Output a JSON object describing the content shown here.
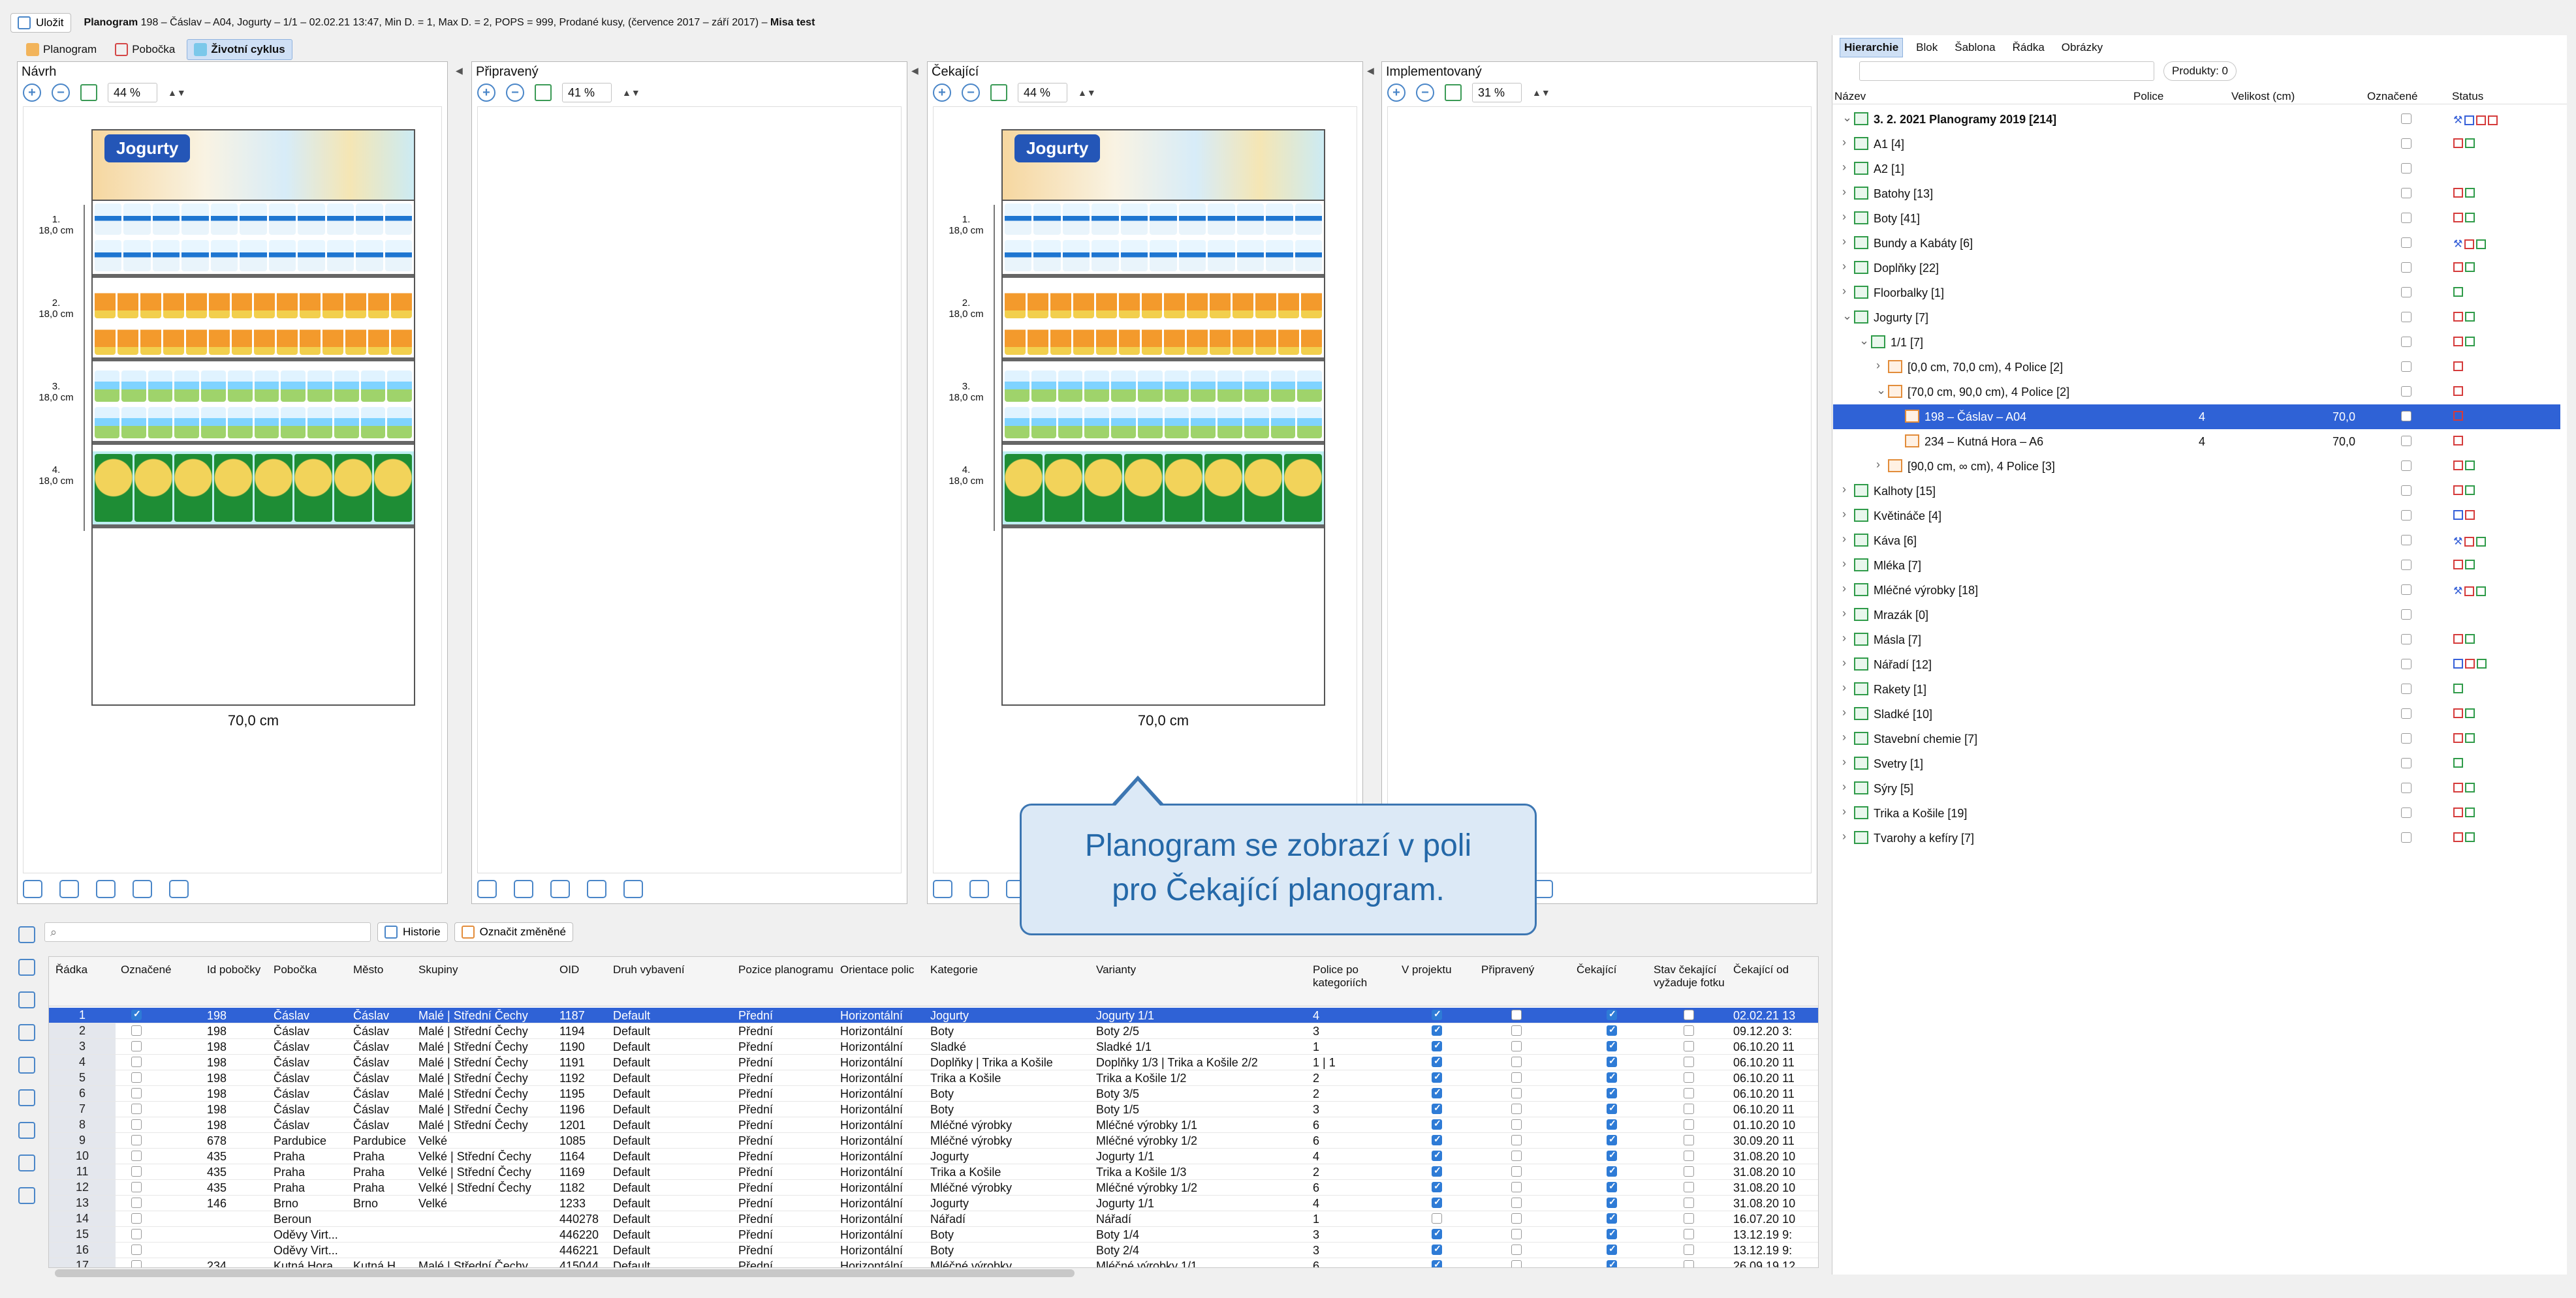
{
  "toolbar": {
    "save_label": "Uložit",
    "title_bold": "Planogram",
    "title_rest": " 198 – Čáslav – A04, Jogurty – 1/1 – 02.02.21 13:47, Min D. = 1, Max D. = 2, POPS = 999, Prodané kusy, (července 2017 – září 2017) – ",
    "title_user": "Misa test"
  },
  "view_tabs": [
    "Planogram",
    "Pobočka",
    "Životní cyklus"
  ],
  "panels": [
    {
      "title": "Návrh",
      "zoom": "44 %"
    },
    {
      "title": "Připravený",
      "zoom": "41 %"
    },
    {
      "title": "Čekající",
      "zoom": "44 %"
    },
    {
      "title": "Implementovaný",
      "zoom": "31 %"
    }
  ],
  "planogram": {
    "brand": "Jogurty",
    "shelves": [
      "1.",
      "2.",
      "3.",
      "4."
    ],
    "shelf_height": "18,0 cm",
    "width_label": "70,0 cm"
  },
  "callout": {
    "line1": "Planogram se zobrazí v poli",
    "line2": "pro Čekající planogram."
  },
  "list_toolbar": {
    "search_placeholder": "",
    "history_label": "Historie",
    "mark_changed_label": "Označit změněné"
  },
  "table": {
    "headers": [
      "Řádka",
      "Označené",
      "Id pobočky",
      "Pobočka",
      "Město",
      "Skupiny",
      "OID",
      "Druh vybavení",
      "Pozice planogramu",
      "Orientace polic",
      "Kategorie",
      "Varianty",
      "Police po kategoriích",
      "V projektu",
      "Připravený",
      "Čekající",
      "Stav čekající vyžaduje fotku",
      "Čekající od"
    ],
    "rows": [
      [
        "1",
        true,
        "198",
        "Čáslav",
        "Čáslav",
        "Malé | Střední Čechy",
        "1187",
        "Default",
        "Přední",
        "Horizontální",
        "Jogurty",
        "Jogurty 1/1",
        "4",
        true,
        false,
        true,
        false,
        "02.02.21 13"
      ],
      [
        "2",
        false,
        "198",
        "Čáslav",
        "Čáslav",
        "Malé | Střední Čechy",
        "1194",
        "Default",
        "Přední",
        "Horizontální",
        "Boty",
        "Boty 2/5",
        "3",
        true,
        false,
        true,
        false,
        "09.12.20 3:"
      ],
      [
        "3",
        false,
        "198",
        "Čáslav",
        "Čáslav",
        "Malé | Střední Čechy",
        "1190",
        "Default",
        "Přední",
        "Horizontální",
        "Sladké",
        "Sladké 1/1",
        "1",
        true,
        false,
        true,
        false,
        "06.10.20 11"
      ],
      [
        "4",
        false,
        "198",
        "Čáslav",
        "Čáslav",
        "Malé | Střední Čechy",
        "1191",
        "Default",
        "Přední",
        "Horizontální",
        "Doplňky | Trika a Košile",
        "Doplňky 1/3 | Trika a Košile 2/2",
        "1 | 1",
        true,
        false,
        true,
        false,
        "06.10.20 11"
      ],
      [
        "5",
        false,
        "198",
        "Čáslav",
        "Čáslav",
        "Malé | Střední Čechy",
        "1192",
        "Default",
        "Přední",
        "Horizontální",
        "Trika a Košile",
        "Trika a Košile 1/2",
        "2",
        true,
        false,
        true,
        false,
        "06.10.20 11"
      ],
      [
        "6",
        false,
        "198",
        "Čáslav",
        "Čáslav",
        "Malé | Střední Čechy",
        "1195",
        "Default",
        "Přední",
        "Horizontální",
        "Boty",
        "Boty 3/5",
        "2",
        true,
        false,
        true,
        false,
        "06.10.20 11"
      ],
      [
        "7",
        false,
        "198",
        "Čáslav",
        "Čáslav",
        "Malé | Střední Čechy",
        "1196",
        "Default",
        "Přední",
        "Horizontální",
        "Boty",
        "Boty 1/5",
        "3",
        true,
        false,
        true,
        false,
        "06.10.20 11"
      ],
      [
        "8",
        false,
        "198",
        "Čáslav",
        "Čáslav",
        "Malé | Střední Čechy",
        "1201",
        "Default",
        "Přední",
        "Horizontální",
        "Mléčné výrobky",
        "Mléčné výrobky 1/1",
        "6",
        true,
        false,
        true,
        false,
        "01.10.20 10"
      ],
      [
        "9",
        false,
        "678",
        "Pardubice",
        "Pardubice",
        "Velké",
        "1085",
        "Default",
        "Přední",
        "Horizontální",
        "Mléčné výrobky",
        "Mléčné výrobky 1/2",
        "6",
        true,
        false,
        true,
        false,
        "30.09.20 11"
      ],
      [
        "10",
        false,
        "435",
        "Praha",
        "Praha",
        "Velké | Střední Čechy",
        "1164",
        "Default",
        "Přední",
        "Horizontální",
        "Jogurty",
        "Jogurty 1/1",
        "4",
        true,
        false,
        true,
        false,
        "31.08.20 10"
      ],
      [
        "11",
        false,
        "435",
        "Praha",
        "Praha",
        "Velké | Střední Čechy",
        "1169",
        "Default",
        "Přední",
        "Horizontální",
        "Trika a Košile",
        "Trika a Košile 1/3",
        "2",
        true,
        false,
        true,
        false,
        "31.08.20 10"
      ],
      [
        "12",
        false,
        "435",
        "Praha",
        "Praha",
        "Velké | Střední Čechy",
        "1182",
        "Default",
        "Přední",
        "Horizontální",
        "Mléčné výrobky",
        "Mléčné výrobky 1/2",
        "6",
        true,
        false,
        true,
        false,
        "31.08.20 10"
      ],
      [
        "13",
        false,
        "146",
        "Brno",
        "Brno",
        "Velké",
        "1233",
        "Default",
        "Přední",
        "Horizontální",
        "Jogurty",
        "Jogurty 1/1",
        "4",
        true,
        false,
        true,
        false,
        "31.08.20 10"
      ],
      [
        "14",
        false,
        "",
        "Beroun",
        "",
        "",
        "440278",
        "Default",
        "Přední",
        "Horizontální",
        "Nářadí",
        "Nářadí",
        "1",
        false,
        false,
        true,
        false,
        "16.07.20 10"
      ],
      [
        "15",
        false,
        "",
        "Oděvy Virt...",
        "",
        "",
        "446220",
        "Default",
        "Přední",
        "Horizontální",
        "Boty",
        "Boty 1/4",
        "3",
        true,
        false,
        true,
        false,
        "13.12.19 9:"
      ],
      [
        "16",
        false,
        "",
        "Oděvy Virt...",
        "",
        "",
        "446221",
        "Default",
        "Přední",
        "Horizontální",
        "Boty",
        "Boty 2/4",
        "3",
        true,
        false,
        true,
        false,
        "13.12.19 9:"
      ],
      [
        "17",
        false,
        "234",
        "Kutná Hora",
        "Kutná H...",
        "Malé | Střední Čechy",
        "415044",
        "Default",
        "Přední",
        "Horizontální",
        "Mléčné výrobky",
        "Mléčné výrobky 1/1",
        "6",
        true,
        false,
        true,
        false,
        "26.09.19 12"
      ]
    ]
  },
  "right_tabs": [
    "Hierarchie",
    "Blok",
    "Šablona",
    "Řádka",
    "Obrázky"
  ],
  "right_filter": "Produkty: 0",
  "right_headers": {
    "name": "Název",
    "shelves": "Police",
    "size": "Velikost (cm)",
    "marked": "Označené",
    "status": "Status"
  },
  "tree": [
    {
      "label": "3. 2. 2021 Planogramy 2019 [214]",
      "bold": true,
      "status": [
        "wrench",
        "blue",
        "red",
        "red"
      ]
    },
    {
      "label": "A1 [4]",
      "status": [
        "red",
        "green"
      ]
    },
    {
      "label": "A2 [1]",
      "status": []
    },
    {
      "label": "Batohy [13]",
      "status": [
        "red",
        "green"
      ]
    },
    {
      "label": "Boty [41]",
      "status": [
        "red",
        "green"
      ]
    },
    {
      "label": "Bundy a Kabáty [6]",
      "status": [
        "wrench",
        "red",
        "green"
      ]
    },
    {
      "label": "Doplňky [22]",
      "status": [
        "red",
        "green"
      ]
    },
    {
      "label": "Floorbalky [1]",
      "status": [
        "green"
      ]
    },
    {
      "label": "Jogurty [7]",
      "status": [
        "red",
        "green"
      ]
    },
    {
      "label": "1/1 [7]",
      "status": [
        "red",
        "green"
      ]
    },
    {
      "label": "[0,0 cm, 70,0 cm), 4 Police [2]",
      "status": [
        "red"
      ]
    },
    {
      "label": "[70,0 cm, 90,0 cm), 4 Police [2]",
      "status": [
        "red"
      ]
    },
    {
      "label": "198 – Čáslav – A04",
      "shelves": "4",
      "size": "70,0",
      "status": [
        "red"
      ],
      "selected": true
    },
    {
      "label": "234 – Kutná Hora – A6",
      "shelves": "4",
      "size": "70,0",
      "status": [
        "red"
      ]
    },
    {
      "label": "[90,0 cm, ∞ cm), 4 Police [3]",
      "status": [
        "red",
        "green"
      ]
    },
    {
      "label": "Kalhoty [15]",
      "status": [
        "red",
        "green"
      ]
    },
    {
      "label": "Květináče [4]",
      "status": [
        "blue",
        "red"
      ]
    },
    {
      "label": "Káva [6]",
      "status": [
        "wrench",
        "red",
        "green"
      ]
    },
    {
      "label": "Mléka [7]",
      "status": [
        "red",
        "green"
      ]
    },
    {
      "label": "Mléčné výrobky [18]",
      "status": [
        "wrench",
        "red",
        "green"
      ]
    },
    {
      "label": "Mrazák [0]",
      "status": []
    },
    {
      "label": "Másla [7]",
      "status": [
        "red",
        "green"
      ]
    },
    {
      "label": "Nářadí [12]",
      "status": [
        "blue",
        "red",
        "green"
      ]
    },
    {
      "label": "Rakety [1]",
      "status": [
        "green"
      ]
    },
    {
      "label": "Sladké [10]",
      "status": [
        "red",
        "green"
      ]
    },
    {
      "label": "Stavební chemie [7]",
      "status": [
        "red",
        "green"
      ]
    },
    {
      "label": "Svetry [1]",
      "status": [
        "green"
      ]
    },
    {
      "label": "Sýry [5]",
      "status": [
        "red",
        "green"
      ]
    },
    {
      "label": "Trika a Košile [19]",
      "status": [
        "red",
        "green"
      ]
    },
    {
      "label": "Tvarohy a kefíry [7]",
      "status": [
        "red",
        "green"
      ]
    }
  ]
}
